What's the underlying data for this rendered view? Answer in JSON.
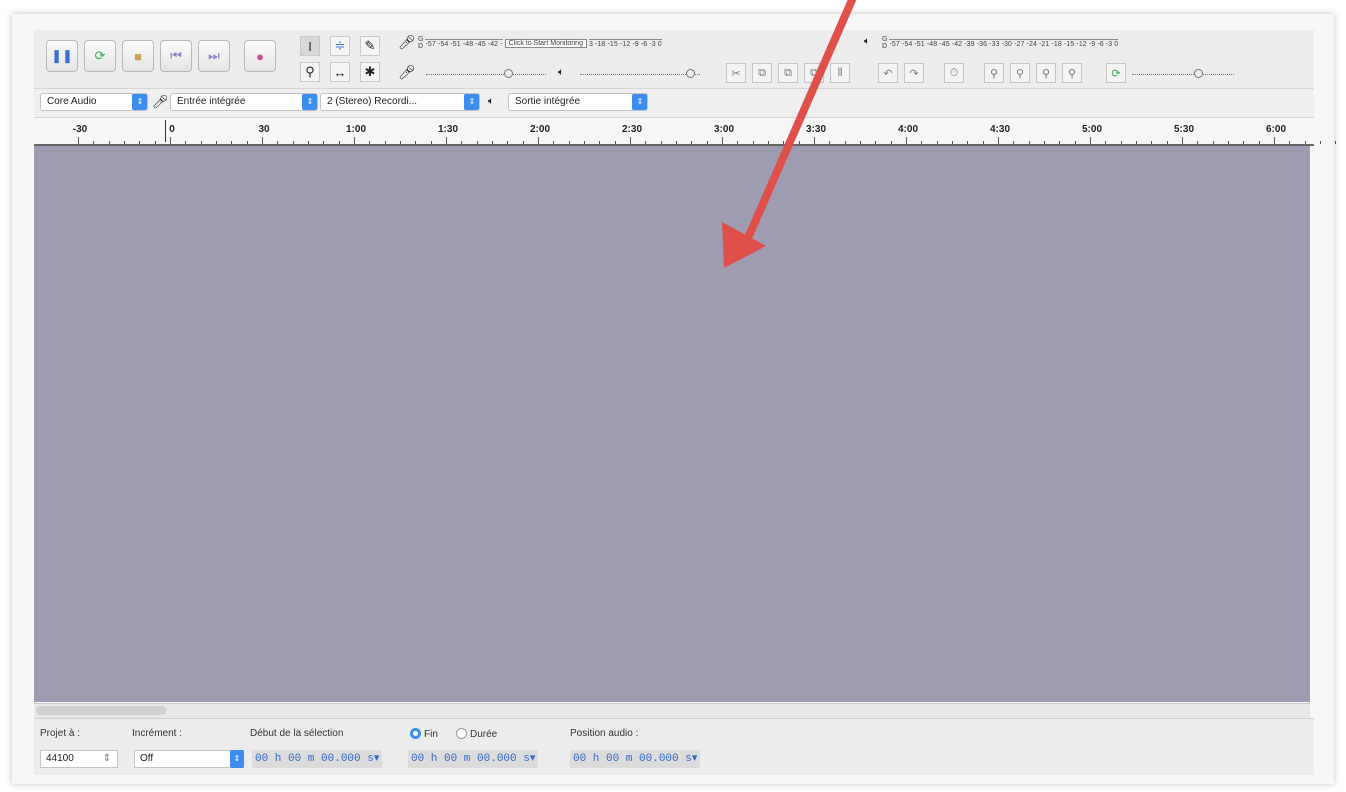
{
  "transport": {
    "pause_icon": "pause-icon",
    "play_icon": "play-icon",
    "stop_icon": "stop-icon",
    "skip_start_icon": "skip-to-start-icon",
    "skip_end_icon": "skip-to-end-icon",
    "record_icon": "record-icon",
    "colors": {
      "play": "#34a853",
      "stop": "#c8a858",
      "skip": "#8e84c8",
      "record": "#c84a9a"
    }
  },
  "meters": {
    "record_scale": "-57 -54 -51 -48 -45 -42 -",
    "record_scale_right": "3 -18 -15 -12 -9 -6 -3 0",
    "monitor_label": "Click to Start Monitoring",
    "playback_scale": "-57 -54 -51 -48 -45 -42 -39 -36 -33 -30 -27 -24 -21 -18 -15 -12 -9 -6 -3 0",
    "channel_label_top": "G",
    "channel_label_bottom": "D"
  },
  "device_bar": {
    "host": "Core Audio",
    "input_device": "Entrée intégrée",
    "channels": "2 (Stereo) Recordi...",
    "output_device": "Sortie intégrée"
  },
  "ruler": {
    "ticks": [
      "-30",
      "0",
      "30",
      "1:00",
      "1:30",
      "2:00",
      "2:30",
      "3:00",
      "3:30",
      "4:00",
      "4:30",
      "5:00",
      "5:30",
      "6:00"
    ]
  },
  "status": {
    "project_rate_label": "Projet à :",
    "project_rate_value": "44100",
    "snap_label": "Incrément :",
    "snap_value": "Off",
    "selection_start_label": "Début de la sélection",
    "end_label": "Fin",
    "length_label": "Durée",
    "audio_position_label": "Position audio :",
    "selection_start_time": "00 h 00 m 00.000 s▾",
    "selection_end_time": "00 h 00 m 00.000 s▾",
    "audio_position_time": "00 h 00 m 00.000 s▾"
  },
  "annotation": {
    "arrow_color": "#e0504a"
  }
}
